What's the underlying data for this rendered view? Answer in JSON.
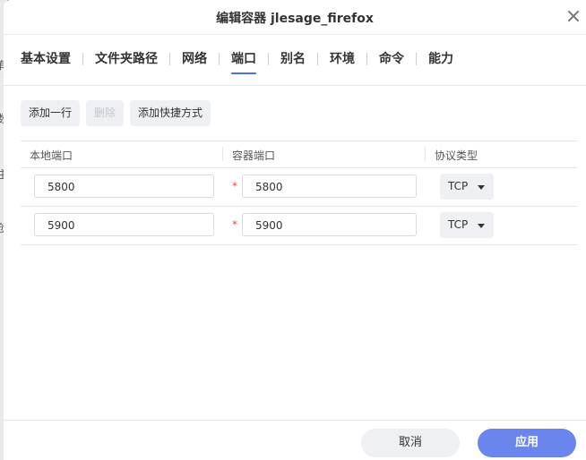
{
  "dialog": {
    "title": "编辑容器 jlesage_firefox",
    "close_icon": "close-icon"
  },
  "background_glyphs": [
    "有",
    "数",
    "主",
    "创"
  ],
  "tabs": [
    {
      "label": "基本设置",
      "active": false
    },
    {
      "label": "文件夹路径",
      "active": false
    },
    {
      "label": "网络",
      "active": false
    },
    {
      "label": "端口",
      "active": true
    },
    {
      "label": "别名",
      "active": false
    },
    {
      "label": "环境",
      "active": false
    },
    {
      "label": "命令",
      "active": false
    },
    {
      "label": "能力",
      "active": false
    }
  ],
  "toolbar": {
    "add_row": "添加一行",
    "delete": "删除",
    "add_shortcut": "添加快捷方式"
  },
  "table": {
    "headers": [
      "本地端口",
      "容器端口",
      "协议类型"
    ],
    "rows": [
      {
        "local_port": "5800",
        "required_mark": "*",
        "container_port": "5800",
        "protocol": "TCP"
      },
      {
        "local_port": "5900",
        "required_mark": "*",
        "container_port": "5900",
        "protocol": "TCP"
      }
    ]
  },
  "footer": {
    "cancel": "取消",
    "apply": "应用"
  },
  "colors": {
    "accent": "#4a6ef0",
    "apply_button": "#6a85ee",
    "required": "#e0504d"
  }
}
